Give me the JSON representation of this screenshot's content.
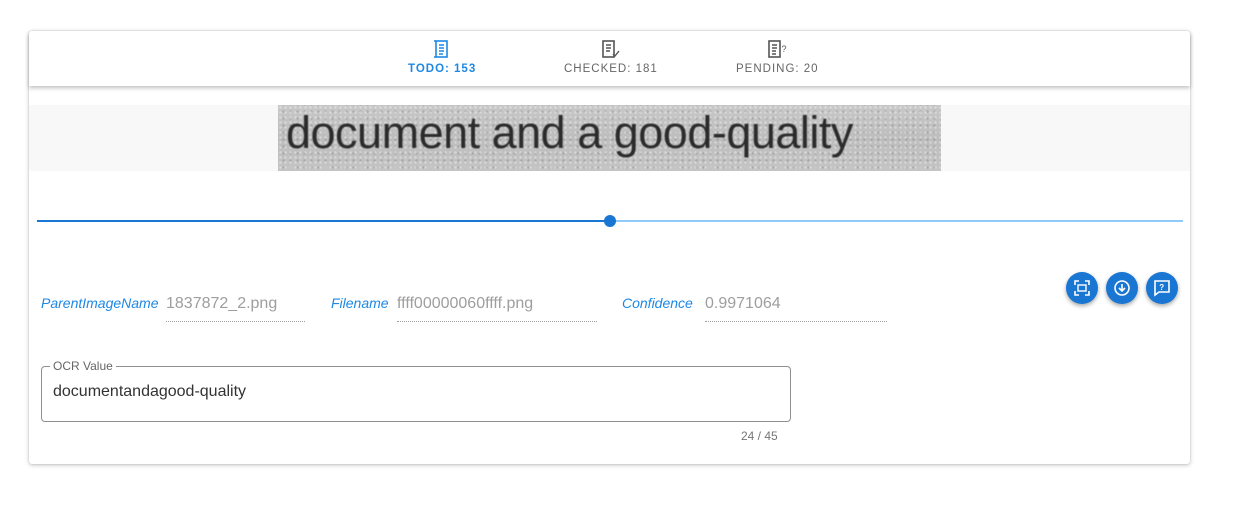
{
  "tabs": [
    {
      "label": "TODO: 153",
      "icon": "todo-list-icon",
      "active": true
    },
    {
      "label": "CHECKED: 181",
      "icon": "checked-list-icon",
      "active": false
    },
    {
      "label": "PENDING: 20",
      "icon": "pending-list-icon",
      "active": false
    }
  ],
  "image": {
    "text": "document and a good-quality"
  },
  "slider": {
    "value_fraction": 0.5
  },
  "fields": {
    "parent_image_name": {
      "label": "ParentImageName",
      "value": "1837872_2.png"
    },
    "filename": {
      "label": "Filename",
      "value": "ffff00000060ffff.png"
    },
    "confidence": {
      "label": "Confidence",
      "value": "0.9971064"
    }
  },
  "actions": [
    {
      "icon": "scan-icon"
    },
    {
      "icon": "download-circle-icon"
    },
    {
      "icon": "feedback-question-icon"
    }
  ],
  "ocr": {
    "label": "OCR Value",
    "value": "documentandagood-quality",
    "counter": "24 / 45"
  },
  "colors": {
    "accent": "#1e88e5",
    "primary": "#1976d2",
    "slider_track": "#90caf9"
  }
}
